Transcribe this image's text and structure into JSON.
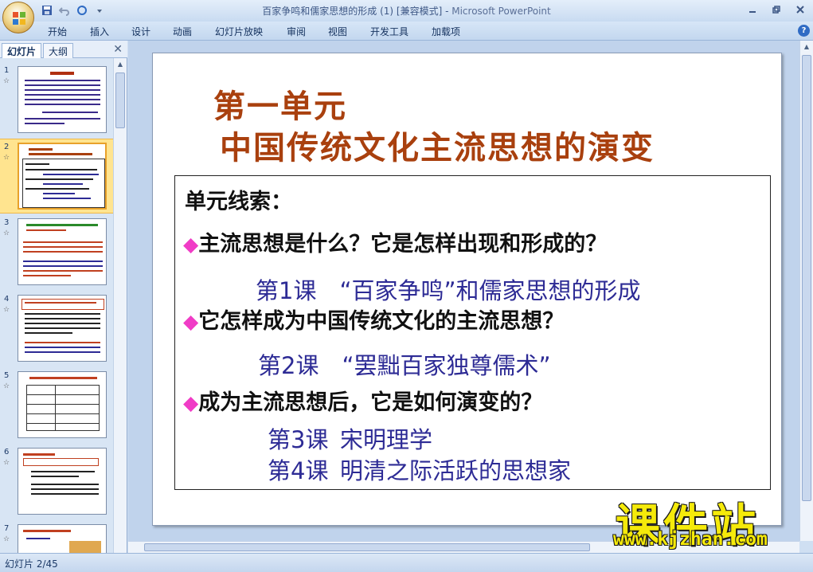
{
  "window": {
    "title": "百家争鸣和儒家思想的形成 (1) [兼容模式]",
    "title_sep": " - ",
    "app_name": "Microsoft PowerPoint"
  },
  "ribbon": {
    "tabs": [
      "开始",
      "插入",
      "设计",
      "动画",
      "幻灯片放映",
      "审阅",
      "视图",
      "开发工具",
      "加载项"
    ],
    "help": "?"
  },
  "pane": {
    "tabs": [
      "幻灯片",
      "大纲"
    ],
    "close": "✕",
    "thumbnails": [
      {
        "num": "1",
        "star": "☆"
      },
      {
        "num": "2",
        "star": "☆"
      },
      {
        "num": "3",
        "star": "☆"
      },
      {
        "num": "4",
        "star": "☆"
      },
      {
        "num": "5",
        "star": "☆"
      },
      {
        "num": "6",
        "star": "☆"
      },
      {
        "num": "7",
        "star": "☆"
      }
    ]
  },
  "slide": {
    "title_line1": "第一单元",
    "title_line2": "中国传统文化主流思想的演变",
    "clue_label": "单元线索：",
    "questions": [
      "主流思想是什么？它是怎样出现和形成的？",
      "它怎样成为中国传统文化的主流思想？",
      "成为主流思想后，它是如何演变的？"
    ],
    "lessons": [
      {
        "num": "第1课",
        "name": "“百家争鸣”和儒家思想的形成"
      },
      {
        "num": "第2课",
        "name": "“罢黜百家独尊儒术”"
      },
      {
        "num": "第3课",
        "name": "宋明理学"
      },
      {
        "num": "第4课",
        "name": "明清之际活跃的思想家"
      }
    ]
  },
  "status": {
    "slide_info": "幻灯片 2/45"
  },
  "watermark": {
    "text": "课件站",
    "url": "www.kjzhan.com"
  },
  "colors": {
    "title": "#a9400e",
    "lesson": "#2d2b95",
    "bullet": "#f03cc6",
    "selected_thumb": "#ffe48f"
  }
}
